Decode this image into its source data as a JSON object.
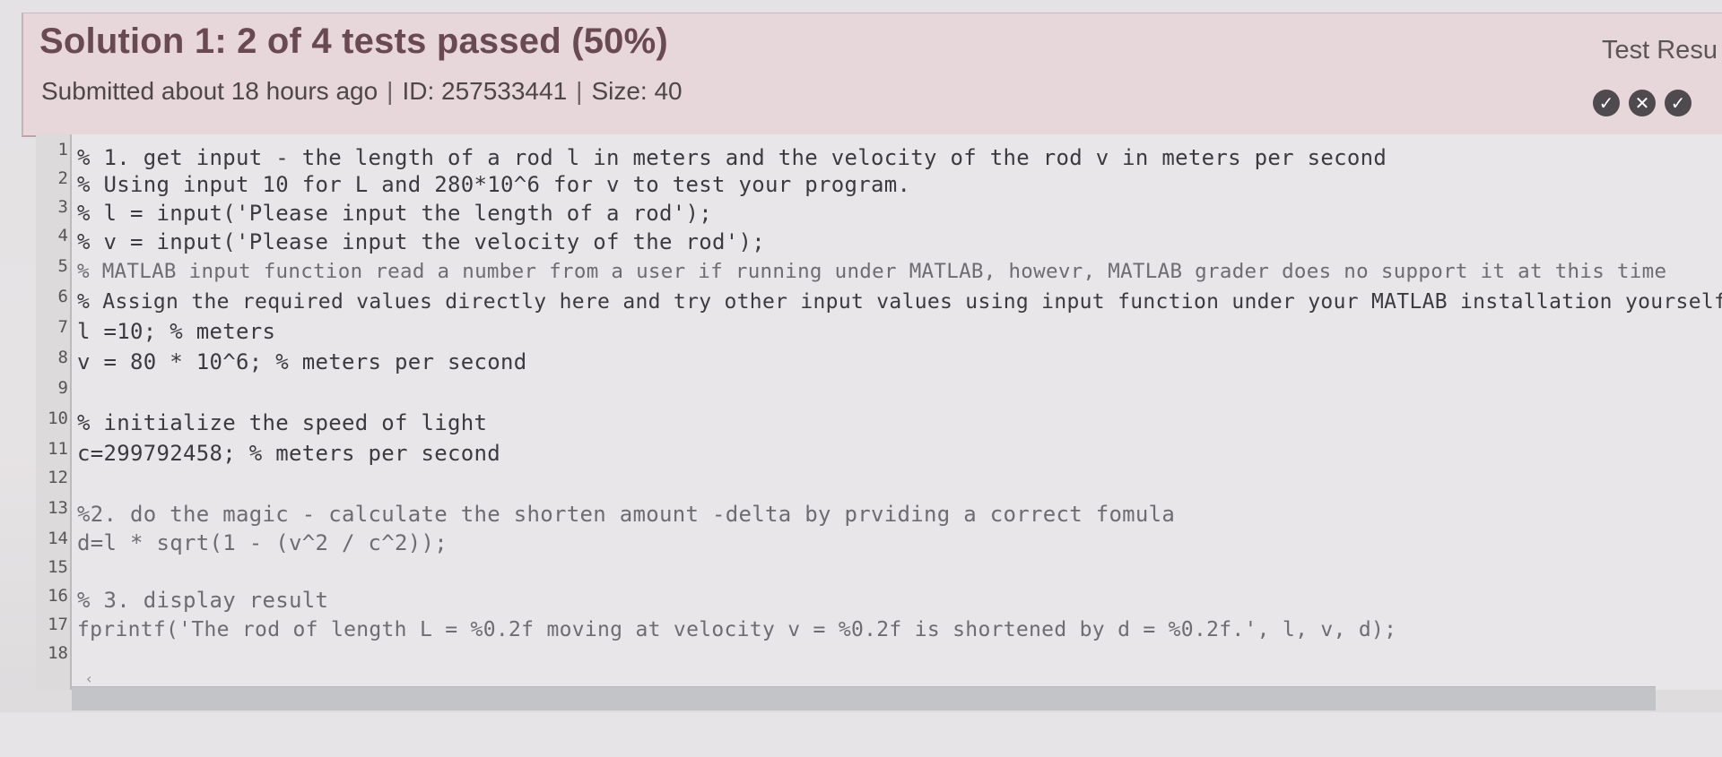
{
  "header": {
    "title": "Solution 1: 2 of 4 tests passed (50%)",
    "submitted": "Submitted about 18 hours ago",
    "id_text": "ID: 257533441",
    "size_text": "Size: 40",
    "separator": "|",
    "test_results_label": "Test Resu"
  },
  "tests": [
    {
      "status": "passed",
      "icon": "✓",
      "icon_name": "check-circle-icon"
    },
    {
      "status": "failed",
      "icon": "✕",
      "icon_name": "x-circle-icon"
    },
    {
      "status": "passed",
      "icon": "✓",
      "icon_name": "check-circle-icon"
    }
  ],
  "code": {
    "line_numbers": [
      "1",
      "2",
      "3",
      "4",
      "5",
      "6",
      "7",
      "8",
      "9",
      "10",
      "11",
      "12",
      "13",
      "14",
      "15",
      "16",
      "17",
      "18"
    ],
    "lines": [
      "% 1. get input -  the length of a rod l in meters and the velocity of the rod v in meters per second",
      "% Using input 10 for L and 280*10^6 for v to test your program.",
      "% l = input('Please input the length of a rod');",
      "% v = input('Please input the velocity of the rod');",
      "% MATLAB input function read a number from a user if running under MATLAB, howevr, MATLAB grader does no support it at this time",
      "% Assign the required values directly here and try other input values using input function under your MATLAB installation yourself",
      "l =10; % meters",
      "v = 80 * 10^6;  % meters per second",
      "",
      "% initialize the speed of light",
      "c=299792458;  % meters per second",
      "",
      "%2. do the magic - calculate the shorten amount -delta by prviding a correct fomula",
      "d=l * sqrt(1 - (v^2 / c^2));",
      "",
      "% 3. display result",
      "fprintf('The rod of length L = %0.2f moving at velocity v = %0.2f is shortened by d = %0.2f.', l, v, d);",
      ""
    ]
  },
  "scrollbar": {
    "left_arrow": "‹"
  },
  "colors": {
    "header_bg": "#e7d6da",
    "title": "#6a4a52",
    "status_icon": "#4f4a4d"
  }
}
